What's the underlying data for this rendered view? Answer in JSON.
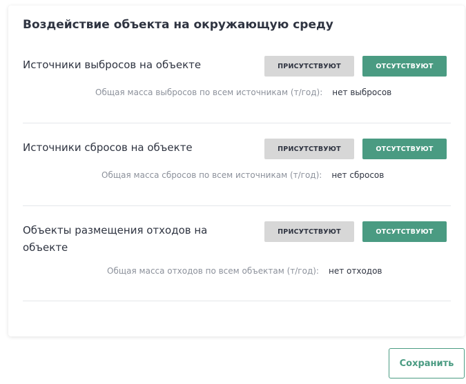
{
  "card": {
    "title": "Воздействие объекта на окружающую среду"
  },
  "sections": [
    {
      "label": "Источники выбросов на объекте",
      "present_label": "присутствуют",
      "absent_label": "отсутствуют",
      "summary_key": "Общая масса выбросов по всем источникам (т/год):",
      "summary_value": "нет выбросов"
    },
    {
      "label": "Источники сбросов на объекте",
      "present_label": "присутствуют",
      "absent_label": "отсутствуют",
      "summary_key": "Общая масса сбросов по всем источникам (т/год):",
      "summary_value": "нет сбросов"
    },
    {
      "label_line1": "Объекты размещения отходов на",
      "label_line2": "объекте",
      "present_label": "присутствуют",
      "absent_label": "отсутствуют",
      "summary_key": "Общая масса отходов по всем объектам (т/год):",
      "summary_value": "нет отходов"
    }
  ],
  "footer": {
    "save_label": "Сохранить"
  },
  "colors": {
    "accent": "#4a9b82",
    "neutral_button": "#d7d7d7",
    "text": "#2f3441",
    "muted": "#8c919b"
  }
}
